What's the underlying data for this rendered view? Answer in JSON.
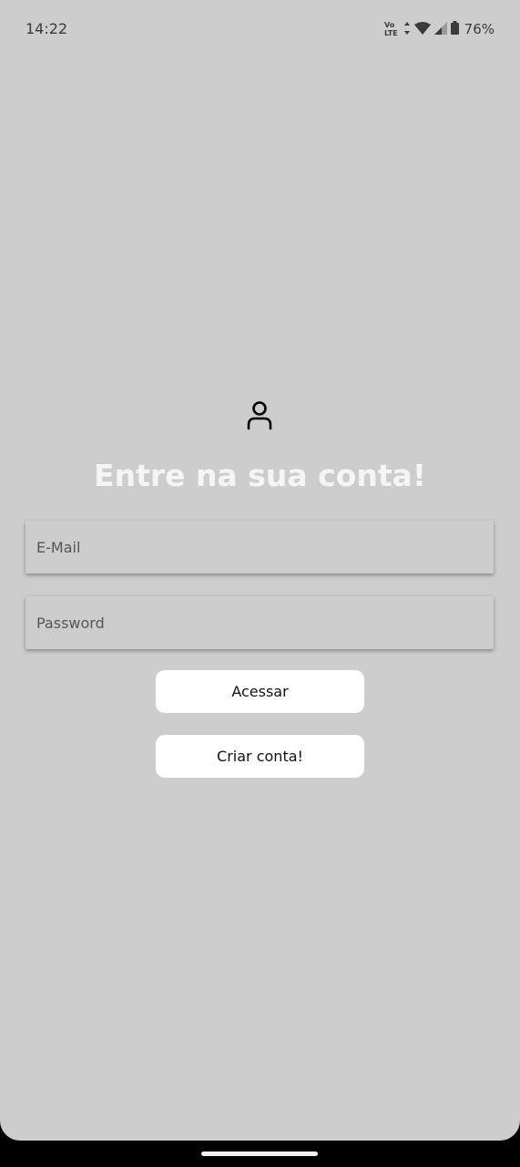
{
  "status_bar": {
    "time": "14:22",
    "volte_top": "Vo",
    "volte_bottom": "LTE",
    "battery_percent": "76%",
    "icons": [
      "data-arrows-icon",
      "wifi-icon",
      "signal-icon",
      "battery-icon"
    ]
  },
  "login": {
    "icon": "user-icon",
    "title": "Entre na sua conta!",
    "email_placeholder": "E-Mail",
    "email_value": "",
    "password_placeholder": "Password",
    "password_value": "",
    "login_button": "Acessar",
    "create_account_button": "Criar conta!"
  },
  "colors": {
    "background": "#cdcdcd",
    "title": "#f5f5f5",
    "button_bg": "#ffffff",
    "nav_bar": "#000000"
  }
}
